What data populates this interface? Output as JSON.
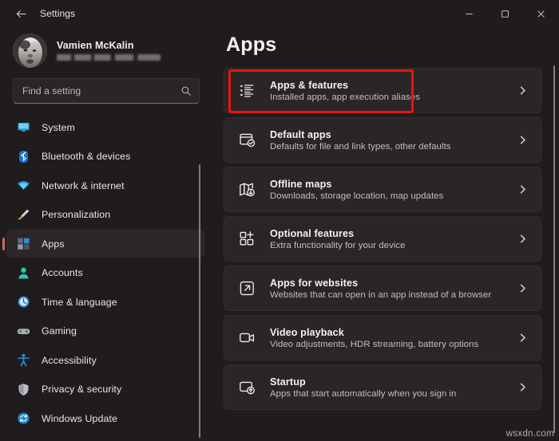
{
  "window": {
    "title": "Settings",
    "back_label": "Back",
    "controls": {
      "minimize": "Minimize",
      "maximize": "Maximize",
      "close": "Close"
    }
  },
  "account": {
    "name": "Vamien McKalin",
    "email_redacted": ""
  },
  "search": {
    "placeholder": "Find a setting",
    "value": ""
  },
  "sidebar": {
    "accent_color": "#d36a63",
    "selected": "Apps",
    "items": [
      {
        "label": "System",
        "icon": "monitor-icon",
        "active": false
      },
      {
        "label": "Bluetooth & devices",
        "icon": "bluetooth-icon",
        "active": false
      },
      {
        "label": "Network & internet",
        "icon": "wifi-icon",
        "active": false
      },
      {
        "label": "Personalization",
        "icon": "brush-icon",
        "active": false
      },
      {
        "label": "Apps",
        "icon": "apps-icon",
        "active": true
      },
      {
        "label": "Accounts",
        "icon": "person-icon",
        "active": false
      },
      {
        "label": "Time & language",
        "icon": "clock-icon",
        "active": false
      },
      {
        "label": "Gaming",
        "icon": "gamepad-icon",
        "active": false
      },
      {
        "label": "Accessibility",
        "icon": "accessibility-icon",
        "active": false
      },
      {
        "label": "Privacy & security",
        "icon": "shield-icon",
        "active": false
      },
      {
        "label": "Windows Update",
        "icon": "update-icon",
        "active": false
      }
    ]
  },
  "main": {
    "title": "Apps",
    "highlighted_card": "Apps & features",
    "highlight_color": "#ee1111",
    "cards": [
      {
        "title": "Apps & features",
        "subtitle": "Installed apps, app execution aliases",
        "icon": "list-bullets-icon",
        "highlighted": true
      },
      {
        "title": "Default apps",
        "subtitle": "Defaults for file and link types, other defaults",
        "icon": "default-apps-icon",
        "highlighted": false
      },
      {
        "title": "Offline maps",
        "subtitle": "Downloads, storage location, map updates",
        "icon": "map-download-icon",
        "highlighted": false
      },
      {
        "title": "Optional features",
        "subtitle": "Extra functionality for your device",
        "icon": "grid-plus-icon",
        "highlighted": false
      },
      {
        "title": "Apps for websites",
        "subtitle": "Websites that can open in an app instead of a browser",
        "icon": "open-external-icon",
        "highlighted": false
      },
      {
        "title": "Video playback",
        "subtitle": "Video adjustments, HDR streaming, battery options",
        "icon": "video-camera-icon",
        "highlighted": false
      },
      {
        "title": "Startup",
        "subtitle": "Apps that start automatically when you sign in",
        "icon": "startup-icon",
        "highlighted": false
      }
    ]
  },
  "watermark": {
    "text": "wsxdn.com"
  }
}
